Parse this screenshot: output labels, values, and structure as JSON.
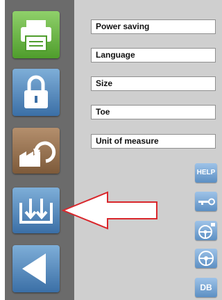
{
  "menu_fields": [
    {
      "label": "Power saving"
    },
    {
      "label": "Language"
    },
    {
      "label": "Size"
    },
    {
      "label": "Toe"
    },
    {
      "label": "Unit of measure"
    }
  ],
  "side_tiles": [
    {
      "icon": "printer-icon"
    },
    {
      "icon": "lock-icon"
    },
    {
      "icon": "factory-reset-icon"
    },
    {
      "icon": "download-icon"
    },
    {
      "icon": "back-arrow-icon"
    }
  ],
  "mini_buttons": {
    "help_label": "HELP",
    "key_icon": "key-icon",
    "steering_lock_icon": "steering-wheel-lock-icon",
    "steering_icon": "steering-wheel-icon",
    "db_label": "DB"
  },
  "colors": {
    "sidebar": "#6b6b6b",
    "content_bg": "#cfcfcf",
    "tile_green": "#5cab36",
    "tile_blue": "#4f86bf",
    "tile_brown": "#8c6746",
    "callout_arrow": "#d9262b"
  }
}
